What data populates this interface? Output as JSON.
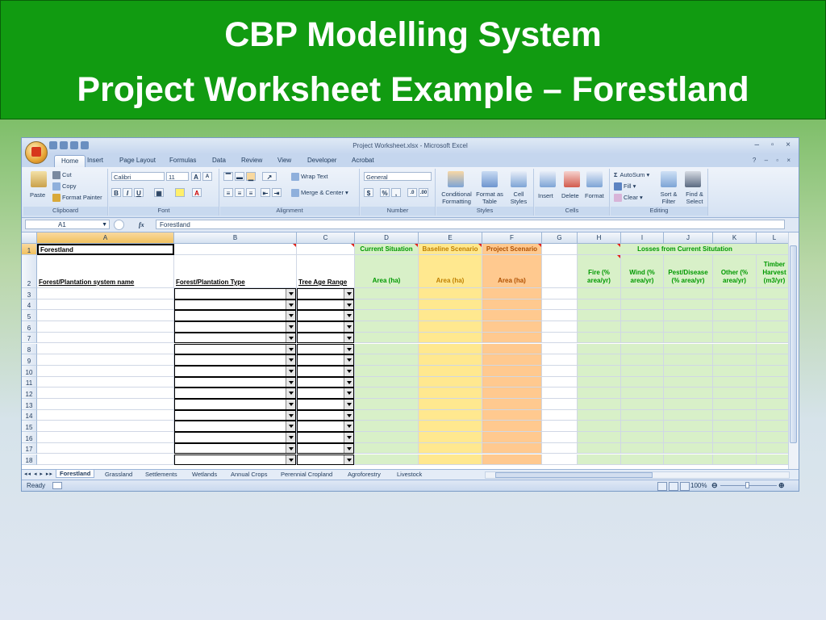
{
  "slide": {
    "title_line1": "CBP Modelling System",
    "title_line2": "Project Worksheet Example – Forestland"
  },
  "window": {
    "title": "Project Worksheet.xlsx - Microsoft Excel",
    "controls": "– ▫ ×"
  },
  "ribbon_tabs": [
    "Home",
    "Insert",
    "Page Layout",
    "Formulas",
    "Data",
    "Review",
    "View",
    "Developer",
    "Acrobat"
  ],
  "ribbon": {
    "clipboard": {
      "paste": "Paste",
      "cut": "Cut",
      "copy": "Copy",
      "format_painter": "Format Painter",
      "label": "Clipboard"
    },
    "font": {
      "name": "Calibri",
      "size": "11",
      "grow": "A",
      "shrink": "A",
      "bold": "B",
      "italic": "I",
      "underline": "U",
      "label": "Font"
    },
    "alignment": {
      "wrap": "Wrap Text",
      "merge": "Merge & Center",
      "label": "Alignment"
    },
    "number": {
      "format": "General",
      "currency": "$",
      "percent": "%",
      "comma": ",",
      "label": "Number"
    },
    "styles": {
      "conditional": "Conditional Formatting",
      "as_table": "Format as Table",
      "cell_styles": "Cell Styles",
      "label": "Styles"
    },
    "cells": {
      "insert": "Insert",
      "delete": "Delete",
      "format": "Format",
      "label": "Cells"
    },
    "editing": {
      "autosum": "AutoSum",
      "fill": "Fill",
      "clear": "Clear",
      "sort": "Sort & Filter",
      "find": "Find & Select",
      "label": "Editing"
    }
  },
  "formula_bar": {
    "name_box": "A1",
    "fx": "fx",
    "content": "Forestland"
  },
  "columns": [
    "A",
    "B",
    "C",
    "D",
    "E",
    "F",
    "G",
    "H",
    "I",
    "J",
    "K",
    "L"
  ],
  "rows": [
    "1",
    "2",
    "3",
    "4",
    "5",
    "6",
    "7",
    "8",
    "9",
    "10",
    "11",
    "12",
    "13",
    "14",
    "15",
    "16",
    "17",
    "18"
  ],
  "cells": {
    "A1": "Forestland",
    "A2": "Forest/Plantation system name",
    "B2": "Forest/Plantation Type",
    "C2": "Tree Age Range",
    "D1": "Current Situation",
    "E1": "Baseline Scenario",
    "F1": "Project Scenario",
    "D2": "Area (ha)",
    "E2": "Area (ha)",
    "F2": "Area (ha)",
    "H1": "Losses from Current Situtation",
    "H2": "Fire (% area/yr)",
    "I2": "Wind (% area/yr)",
    "J2": "Pest/Disease (% area/yr)",
    "K2": "Other (% area/yr)",
    "L2": "Timber Harvest (m3/yr)"
  },
  "sheet_tabs": [
    "Forestland",
    "Grassland",
    "Settlements",
    "Wetlands",
    "Annual Crops",
    "Perennial Cropland",
    "Agroforestry",
    "Livestock"
  ],
  "status": {
    "ready": "Ready",
    "zoom": "100%"
  },
  "colors": {
    "banner": "#119b11",
    "current_fill": "#d8f0c8",
    "baseline_fill": "#ffe88f",
    "project_fill": "#ffc98f",
    "losses_fill": "#d8f0c8",
    "current_text": "#009900",
    "baseline_text": "#c08000",
    "project_text": "#b05000"
  }
}
